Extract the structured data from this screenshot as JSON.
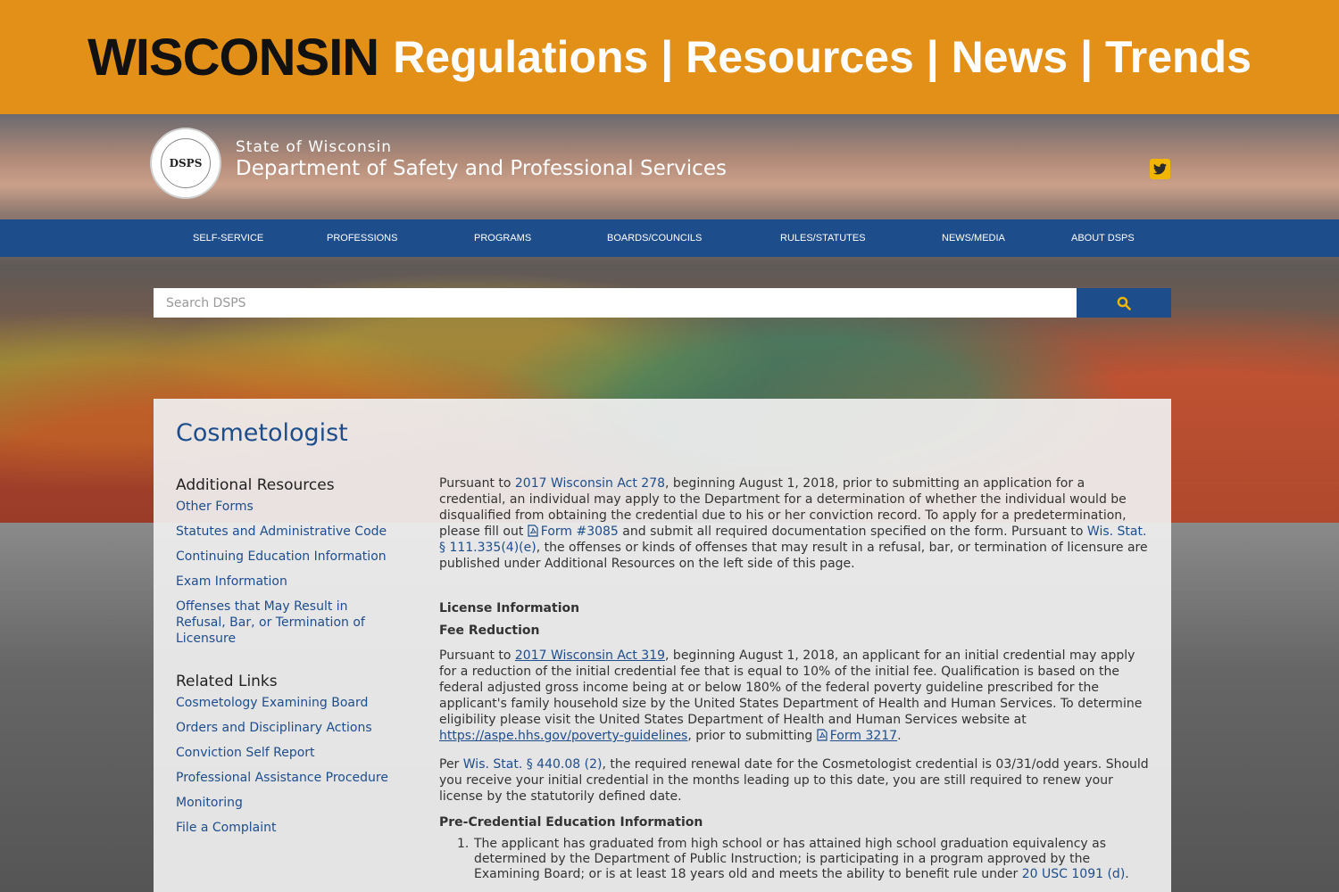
{
  "banner": {
    "state": "WISCONSIN",
    "tagline": "Regulations | Resources | News | Trends"
  },
  "header": {
    "state_name": "State of Wisconsin",
    "department": "Department of Safety and Professional Services",
    "logo_text": "DSPS"
  },
  "nav": {
    "items": [
      {
        "label": "SELF-SERVICE"
      },
      {
        "label": "PROFESSIONS"
      },
      {
        "label": "PROGRAMS"
      },
      {
        "label": "BOARDS/COUNCILS"
      },
      {
        "label": "RULES/STATUTES"
      },
      {
        "label": "NEWS/MEDIA"
      },
      {
        "label": "ABOUT DSPS"
      }
    ]
  },
  "search": {
    "placeholder": "Search DSPS"
  },
  "page": {
    "title": "Cosmetologist"
  },
  "sidebar": {
    "additional_heading": "Additional Resources",
    "additional_links": [
      "Other Forms",
      "Statutes and Administrative Code",
      "Continuing Education Information",
      "Exam Information",
      "Offenses that May Result in Refusal, Bar, or Termination of Licensure"
    ],
    "related_heading": "Related Links",
    "related_links": [
      "Cosmetology Examining Board",
      "Orders and Disciplinary Actions",
      "Conviction Self Report",
      "Professional Assistance Procedure",
      "Monitoring",
      "File a Complaint"
    ]
  },
  "content": {
    "intro": {
      "t1": "Pursuant to ",
      "link_act278": "2017 Wisconsin Act 278",
      "t2": ", beginning August 1, 2018, prior to submitting an application for a credential, an individual may apply to the Department for a determination of whether the individual would be disqualified from obtaining the credential due to his or her conviction record.  To apply for a predetermination, please fill out ",
      "link_form3085": "Form #3085",
      "t3": " and submit all required documentation specified on the form.  Pursuant to ",
      "link_stat": "Wis. Stat. § 111.335(4)(e)",
      "t4": ", the offenses or kinds of offenses that may result in a refusal, bar, or termination of licensure are published under Additional Resources on the left side of this page."
    },
    "license_heading": "License Information",
    "fee_heading": "Fee Reduction",
    "fee": {
      "t1": "Pursuant to ",
      "link_act319": "2017 Wisconsin Act 319",
      "t2": ", beginning August 1, 2018, an applicant for an initial credential may apply for a reduction of the initial credential fee that is equal to 10% of the initial fee.  Qualification is based on the federal adjusted gross income being at or below 180% of the federal poverty guideline prescribed for the applicant's family household size by the United States Department of Health and Human Services. To determine eligibility please visit the United States Department of Health and Human Services website at ",
      "link_hhs": "https://aspe.hhs.gov/poverty-guidelines",
      "t3": ", prior to submitting ",
      "link_form3217": "Form 3217",
      "t4": "."
    },
    "renewal": {
      "t1": "Per ",
      "link_stat": "Wis. Stat. § 440.08 (2)",
      "t2": ", the required renewal date for the Cosmetologist credential is 03/31/odd years. Should you receive your initial credential in the months leading up to this date, you are still required to renew your license by the statutorily defined date."
    },
    "precred_heading": "Pre-Credential Education Information",
    "list": [
      {
        "num": "1.",
        "text": "The applicant has graduated from high school or has attained high school graduation equivalency as determined by the Department of Public Instruction; is participating in a program approved by the Examining Board; or is at least 18 years old and meets the ability to benefit rule under ",
        "link": "20 USC 1091 (d)",
        "end": "."
      }
    ]
  },
  "colors": {
    "banner": "#e39019",
    "nav": "#1e4d8c",
    "link": "#1e4d8c",
    "twitter": "#f2b600"
  }
}
